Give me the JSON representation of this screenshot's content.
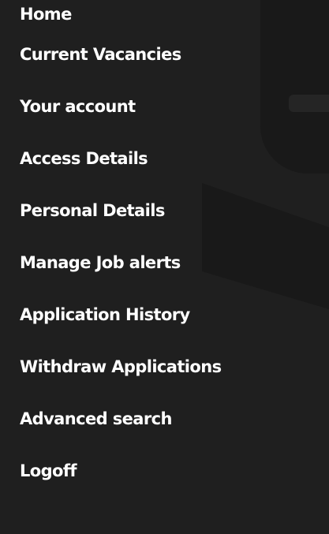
{
  "nav": {
    "items": [
      {
        "label": "Home"
      },
      {
        "label": "Current Vacancies"
      },
      {
        "label": "Your account"
      },
      {
        "label": "Access Details"
      },
      {
        "label": "Personal Details"
      },
      {
        "label": "Manage Job alerts"
      },
      {
        "label": "Application History"
      },
      {
        "label": "Withdraw Applications"
      },
      {
        "label": "Advanced search"
      },
      {
        "label": "Logoff"
      }
    ]
  },
  "colors": {
    "background": "#1f1f1f",
    "text": "#ffffff",
    "watermark": "#191919"
  }
}
